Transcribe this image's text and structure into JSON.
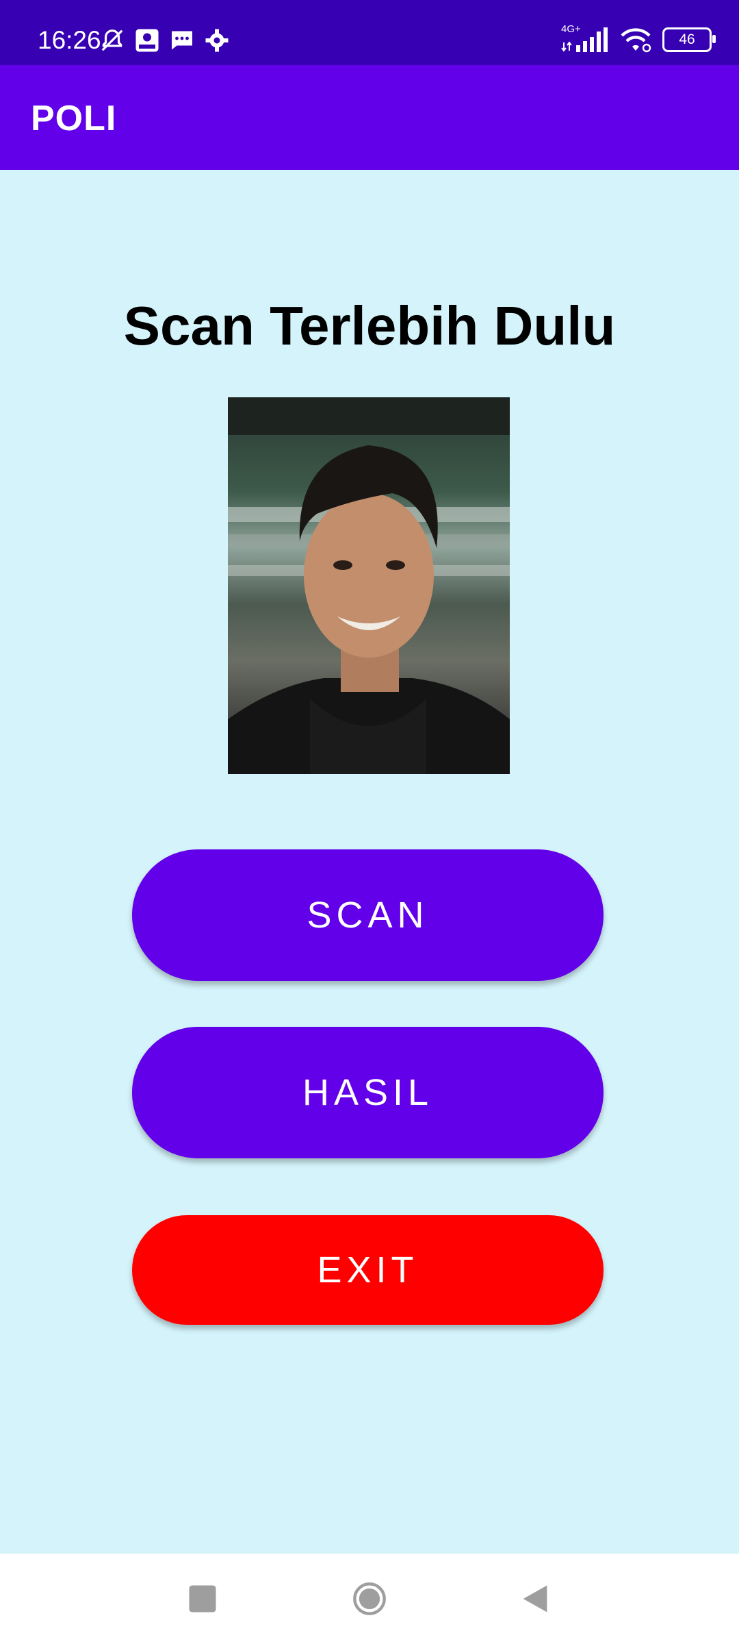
{
  "status_bar": {
    "time": "16:26",
    "left_icons": [
      "bell-off-icon",
      "tiket-app-icon",
      "message-icon",
      "gear-icon"
    ],
    "network_label": "4G+",
    "battery_level": "46"
  },
  "app_bar": {
    "title": "POLI"
  },
  "main": {
    "heading": "Scan Terlebih Dulu",
    "photo_alt": "Foto wajah"
  },
  "buttons": {
    "scan_label": "SCAN",
    "hasil_label": "HASIL",
    "exit_label": "EXIT"
  },
  "colors": {
    "status_bar": "#3700b3",
    "app_bar": "#6200ea",
    "background": "#d4f3fa",
    "primary_button": "#6200ea",
    "exit_button": "#ff0000"
  },
  "nav_bar": {
    "icons": [
      "recents-square-icon",
      "home-circle-icon",
      "back-triangle-icon"
    ]
  }
}
